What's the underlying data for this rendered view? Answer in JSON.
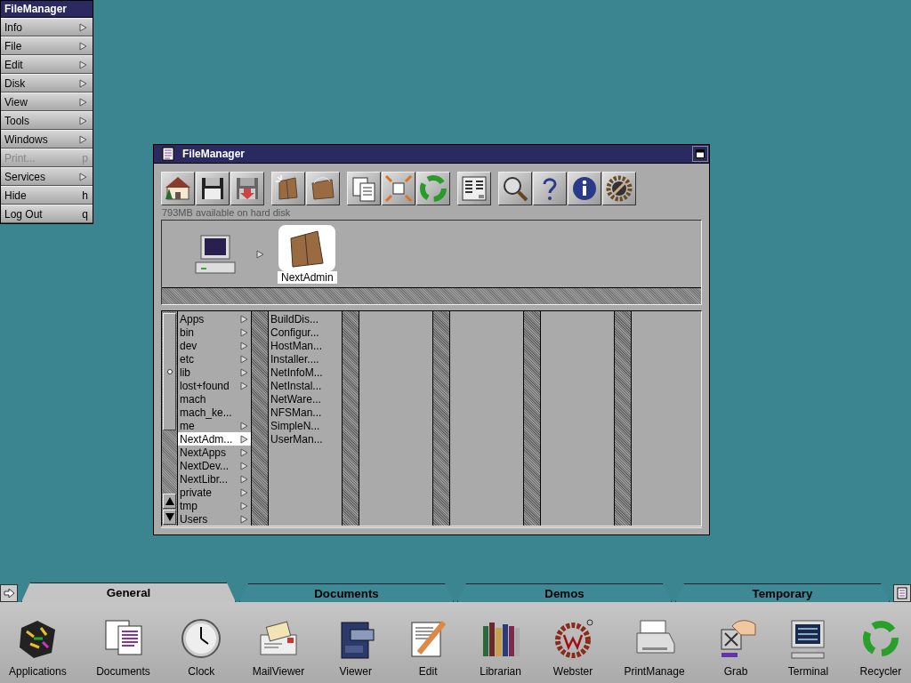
{
  "menu": {
    "title": "FileManager",
    "items": [
      {
        "label": "Info",
        "submenu": true,
        "disabled": false
      },
      {
        "label": "File",
        "submenu": true,
        "disabled": false
      },
      {
        "label": "Edit",
        "submenu": true,
        "disabled": false
      },
      {
        "label": "Disk",
        "submenu": true,
        "disabled": false
      },
      {
        "label": "View",
        "submenu": true,
        "disabled": false
      },
      {
        "label": "Tools",
        "submenu": true,
        "disabled": false
      },
      {
        "label": "Windows",
        "submenu": true,
        "disabled": false
      },
      {
        "label": "Print...",
        "submenu": false,
        "key": "p",
        "disabled": true
      },
      {
        "label": "Services",
        "submenu": true,
        "disabled": false
      },
      {
        "label": "Hide",
        "submenu": false,
        "key": "h",
        "disabled": false
      },
      {
        "label": "Log Out",
        "submenu": false,
        "key": "q",
        "disabled": false
      }
    ]
  },
  "window": {
    "title": "FileManager",
    "status": "793MB available on hard disk",
    "path": [
      {
        "kind": "computer",
        "selected": false
      },
      {
        "kind": "folder",
        "label": "NextAdmin",
        "selected": true
      }
    ],
    "columns": [
      {
        "items": [
          {
            "name": "Apps",
            "has_children": true,
            "selected": false
          },
          {
            "name": "bin",
            "has_children": true,
            "selected": false
          },
          {
            "name": "dev",
            "has_children": true,
            "selected": false
          },
          {
            "name": "etc",
            "has_children": true,
            "selected": false
          },
          {
            "name": "lib",
            "has_children": true,
            "selected": false
          },
          {
            "name": "lost+found",
            "has_children": true,
            "selected": false
          },
          {
            "name": "mach",
            "has_children": false,
            "selected": false
          },
          {
            "name": "mach_ke...",
            "has_children": false,
            "selected": false
          },
          {
            "name": "me",
            "has_children": true,
            "selected": false
          },
          {
            "name": "NextAdm...",
            "has_children": true,
            "selected": true
          },
          {
            "name": "NextApps",
            "has_children": true,
            "selected": false
          },
          {
            "name": "NextDev...",
            "has_children": true,
            "selected": false
          },
          {
            "name": "NextLibr...",
            "has_children": true,
            "selected": false
          },
          {
            "name": "private",
            "has_children": true,
            "selected": false
          },
          {
            "name": "tmp",
            "has_children": true,
            "selected": false
          },
          {
            "name": "Users",
            "has_children": true,
            "selected": false
          }
        ]
      },
      {
        "items": [
          {
            "name": "BuildDis...",
            "has_children": false,
            "selected": false
          },
          {
            "name": "Configur...",
            "has_children": false,
            "selected": false
          },
          {
            "name": "HostMan...",
            "has_children": false,
            "selected": false
          },
          {
            "name": "Installer....",
            "has_children": false,
            "selected": false
          },
          {
            "name": "NetInfoM...",
            "has_children": false,
            "selected": false
          },
          {
            "name": "NetInstal...",
            "has_children": false,
            "selected": false
          },
          {
            "name": "NetWare...",
            "has_children": false,
            "selected": false
          },
          {
            "name": "NFSMan...",
            "has_children": false,
            "selected": false
          },
          {
            "name": "SimpleN...",
            "has_children": false,
            "selected": false
          },
          {
            "name": "UserMan...",
            "has_children": false,
            "selected": false
          }
        ]
      }
    ]
  },
  "dock": {
    "tabs": [
      {
        "label": "General",
        "selected": true
      },
      {
        "label": "Documents",
        "selected": false
      },
      {
        "label": "Demos",
        "selected": false
      },
      {
        "label": "Temporary",
        "selected": false
      }
    ],
    "apps": [
      {
        "label": "Applications",
        "kind": "cube"
      },
      {
        "label": "Documents",
        "kind": "docs"
      },
      {
        "label": "Clock",
        "kind": "clock"
      },
      {
        "label": "MailViewer",
        "kind": "mail"
      },
      {
        "label": "Viewer",
        "kind": "cabinet"
      },
      {
        "label": "Edit",
        "kind": "pencil"
      },
      {
        "label": "Librarian",
        "kind": "books"
      },
      {
        "label": "Webster",
        "kind": "wreath"
      },
      {
        "label": "PrintManage",
        "kind": "printer"
      },
      {
        "label": "Grab",
        "kind": "grab"
      },
      {
        "label": "Terminal",
        "kind": "terminal"
      },
      {
        "label": "Recycler",
        "kind": "recycle"
      }
    ]
  }
}
